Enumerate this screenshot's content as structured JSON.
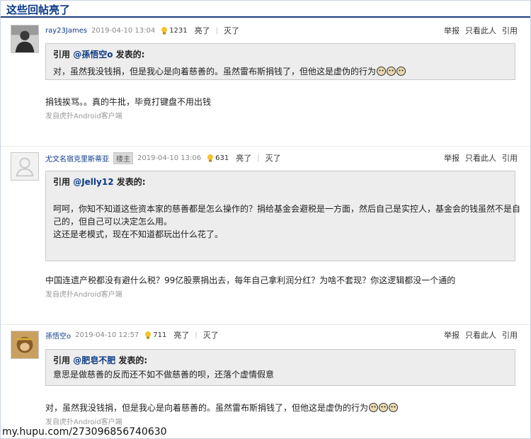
{
  "section_title": "这些回帖亮了",
  "posts": [
    {
      "username": "ray23James",
      "time": "2019-04-10 13:04",
      "likes": "1231",
      "light_label": "亮了",
      "sep": "|",
      "dim_label": "灭了",
      "ops": [
        "举报",
        "只看此人",
        "引用"
      ],
      "quote": {
        "prefix": "引用 ",
        "user": "@孫悟空o",
        "suffix": " 发表的:",
        "lines": [
          "对，虽然我没钱捐，但是我心是向着慈善的。虽然雷布斯捐钱了，但他这是虚伪的行为"
        ]
      },
      "body": "捐钱挨骂。。真的牛批，毕竟打键盘不用出钱",
      "source": "发自虎扑Android客户端"
    },
    {
      "username": "尤文名宿克里斯蒂亚",
      "badge": "楼主",
      "time": "2019-04-10 13:06",
      "likes": "631",
      "light_label": "亮了",
      "sep": "|",
      "dim_label": "灭了",
      "ops": [
        "举报",
        "只看此人",
        "引用"
      ],
      "quote": {
        "prefix": "引用 ",
        "user": "@Jelly12",
        "suffix": " 发表的:",
        "lines": [
          "呵呵，你知不知道这些资本家的慈善都是怎么操作的？捐给基金会避税是一方面，然后自己是实控人，基金会的钱虽然不是自",
          "己的，但自己可以决定怎么用。",
          "这还是老模式，现在不知道都玩出什么花了。"
        ]
      },
      "body": "中国连遗产税都没有避什么税？99亿股票捐出去，每年自己拿利润分红？为啥不套现？你这逻辑都没一个通的",
      "source": "发自虎扑Android客户端"
    },
    {
      "username": "孫悟空o",
      "time": "2019-04-10 12:57",
      "likes": "711",
      "light_label": "亮了",
      "sep": "|",
      "dim_label": "灭了",
      "ops": [
        "举报",
        "只看此人",
        "引用"
      ],
      "quote": {
        "prefix": "引用 ",
        "user": "@肥皂不肥",
        "suffix": " 发表的:",
        "lines": [
          "意思是做慈善的反而还不如不做慈善的呗，还落个虚情假意"
        ]
      },
      "body": "对，虽然我没钱捐，但是我心是向着慈善的。虽然雷布斯捐钱了，但他这是虚伪的行为",
      "source": "发自虎扑Android客户端"
    }
  ],
  "watermark": "my.hupu.com/273096856740630",
  "colors": {
    "link": "#0c3a86",
    "quote_bg": "#ededed",
    "header_rule": "#1c3d7a"
  }
}
